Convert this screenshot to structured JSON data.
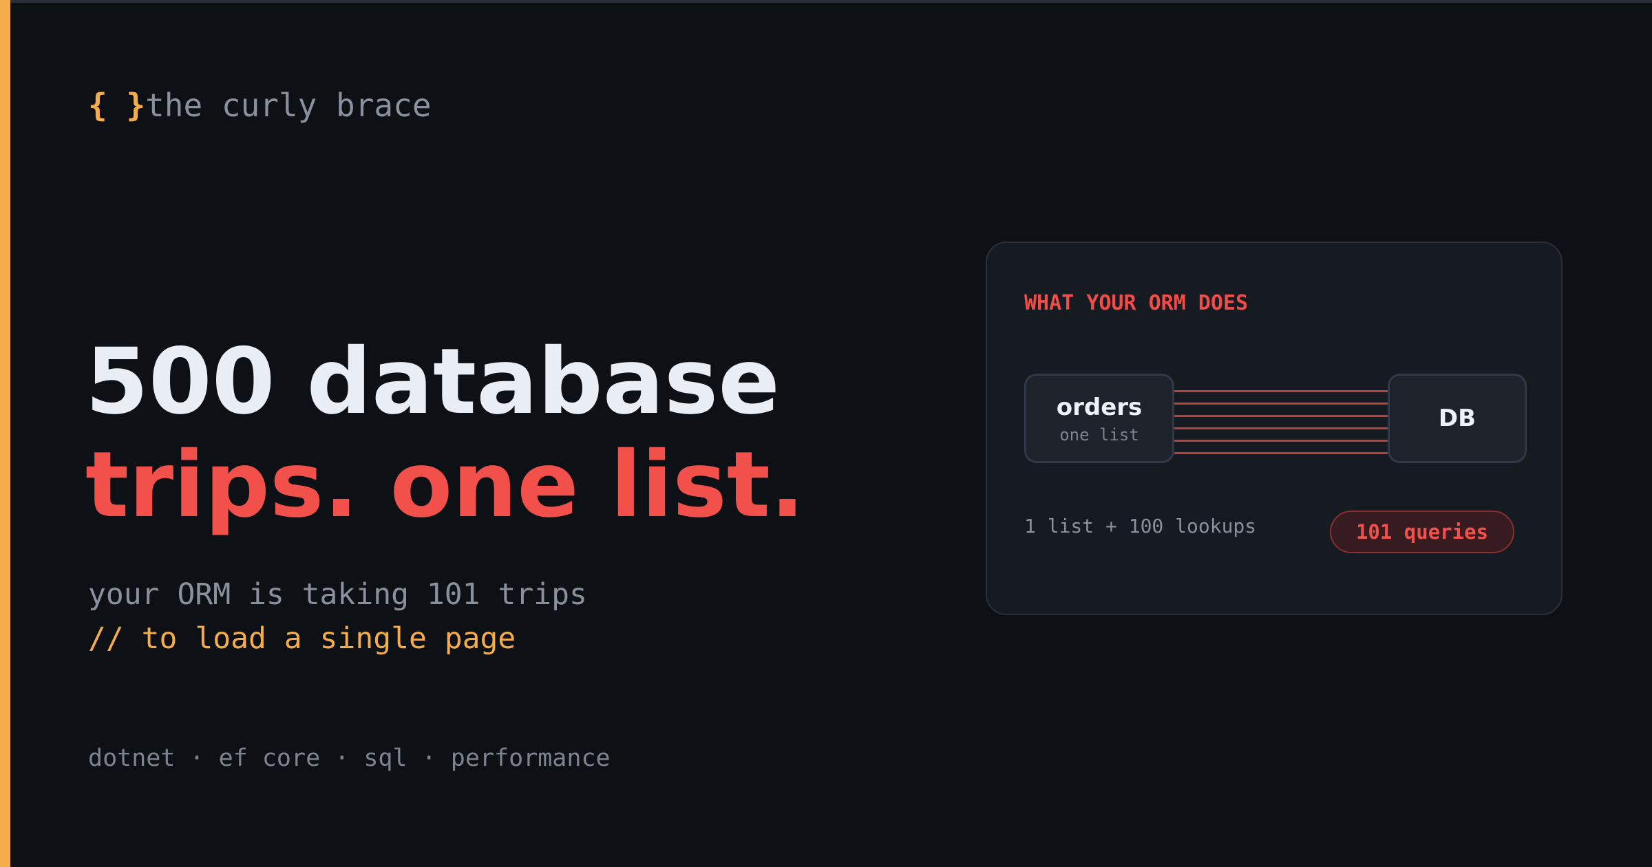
{
  "brand": {
    "mark": "{ }",
    "name": "the curly brace"
  },
  "headline": {
    "line1": "500 database",
    "line2": "trips. one list."
  },
  "subtitle": {
    "line1": "your ORM is taking 101 trips",
    "line2": "// to load a single page"
  },
  "tags": "dotnet · ef core · sql · performance",
  "card": {
    "title": "WHAT YOUR ORM DOES",
    "source": {
      "label": "orders",
      "sublabel": "one list"
    },
    "target": {
      "label": "DB"
    },
    "connection_count": 6,
    "note": "1 list + 100 lookups",
    "badge": "101 queries"
  },
  "colors": {
    "background": "#0d1015",
    "accent": "#f5ad4c",
    "alert": "#f2504b",
    "text_primary": "#e9eef4",
    "text_muted": "#8a919c"
  }
}
